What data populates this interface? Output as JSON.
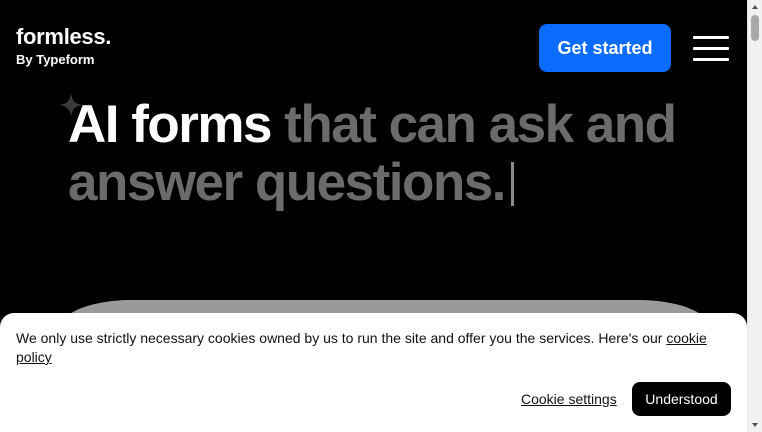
{
  "header": {
    "logo_word": "formless.",
    "logo_sub": "By Typeform",
    "cta_label": "Get started",
    "menu_icon": "hamburger-menu-icon"
  },
  "hero": {
    "line_bright": "AI forms",
    "line_dim": " that can ask and answer questions.",
    "sparkle_icon": "sparkle-icon"
  },
  "cookie_banner": {
    "text": "We only use strictly necessary cookies owned by us to run the site and offer you the services. Here's our ",
    "link_label": "cookie policy",
    "settings_label": "Cookie settings",
    "accept_label": "Understood"
  },
  "colors": {
    "accent": "#0a6cff",
    "background": "#000000",
    "hero_dim": "#6b6b6b"
  }
}
